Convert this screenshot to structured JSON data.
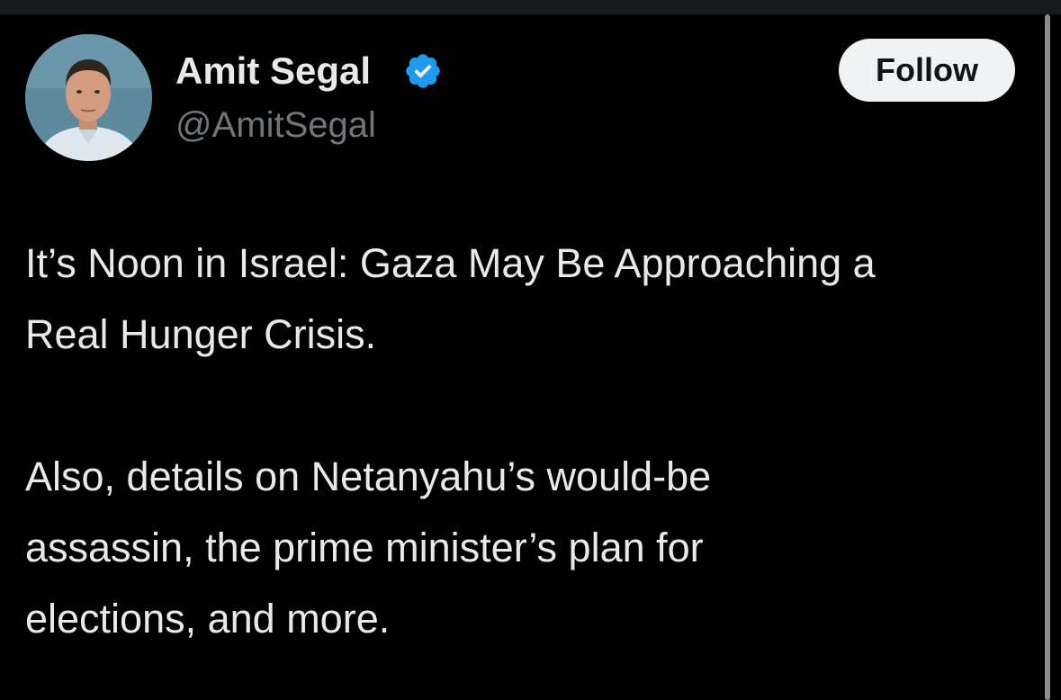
{
  "author": {
    "display_name": "Amit Segal",
    "handle": "@AmitSegal",
    "verified": true,
    "avatar_icon": "profile-photo"
  },
  "follow_label": "Follow",
  "tweet": {
    "paragraph_1_line_1": "It’s Noon in Israel: Gaza May Be Approaching a",
    "paragraph_1_line_2": "Real Hunger Crisis.",
    "paragraph_2_line_1": "Also, details on Netanyahu’s would-be",
    "paragraph_2_line_2": "assassin, the prime minister’s plan for",
    "paragraph_2_line_3": "elections, and more."
  },
  "colors": {
    "background": "#000000",
    "text_primary": "#e7e9ea",
    "text_secondary": "#71767b",
    "verified_blue": "#1d9bf0",
    "follow_bg": "#eff3f4",
    "follow_text": "#0f1419"
  }
}
